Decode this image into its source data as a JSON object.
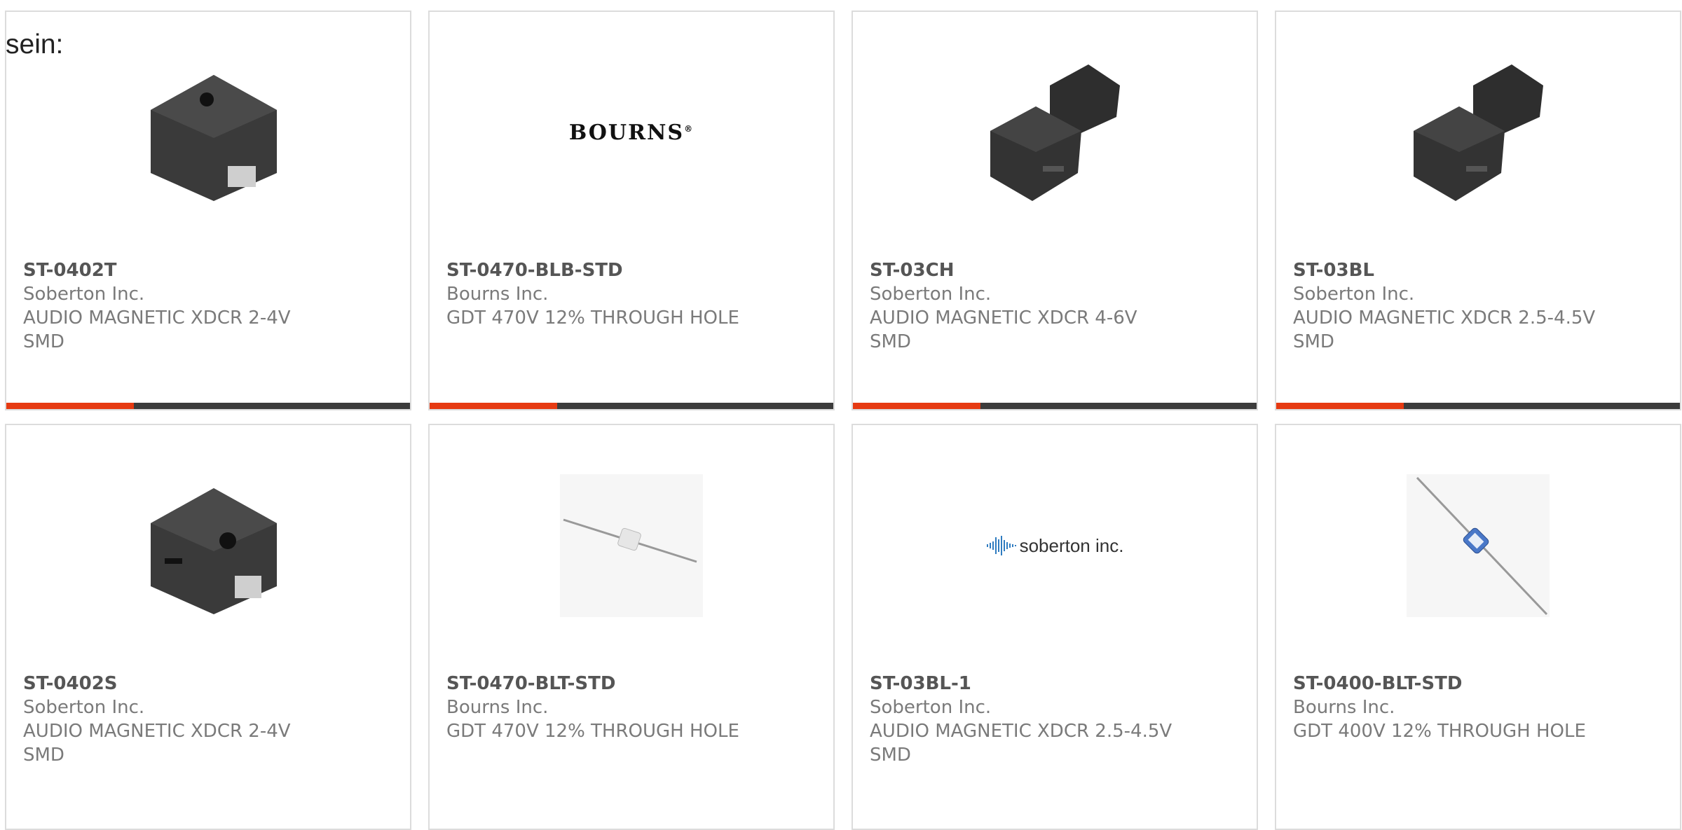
{
  "intro_text": "sein:",
  "accent_color": "#e63a12",
  "bar_color": "#3c3c3c",
  "products": [
    {
      "part": "ST-0402T",
      "manufacturer": "Soberton Inc.",
      "desc1": "AUDIO MAGNETIC XDCR 2-4V",
      "desc2": "SMD",
      "image": "smd-buzzer-square-photo"
    },
    {
      "part": "ST-0470-BLB-STD",
      "manufacturer": "Bourns Inc.",
      "desc1": "GDT 470V 12% THROUGH HOLE",
      "desc2": "",
      "image": "bourns-logo",
      "logo_text": "BOURNS"
    },
    {
      "part": "ST-03CH",
      "manufacturer": "Soberton Inc.",
      "desc1": "AUDIO MAGNETIC XDCR 4-6V",
      "desc2": "SMD",
      "image": "smd-buzzer-pair-photo"
    },
    {
      "part": "ST-03BL",
      "manufacturer": "Soberton Inc.",
      "desc1": "AUDIO MAGNETIC XDCR 2.5-4.5V",
      "desc2": "SMD",
      "image": "smd-buzzer-pair-photo"
    },
    {
      "part": "ST-0402S",
      "manufacturer": "Soberton Inc.",
      "desc1": "AUDIO MAGNETIC XDCR 2-4V",
      "desc2": "SMD",
      "image": "smd-buzzer-square-photo"
    },
    {
      "part": "ST-0470-BLT-STD",
      "manufacturer": "Bourns Inc.",
      "desc1": "GDT 470V 12% THROUGH HOLE",
      "desc2": "",
      "image": "gdt-axial-white-photo"
    },
    {
      "part": "ST-03BL-1",
      "manufacturer": "Soberton Inc.",
      "desc1": "AUDIO MAGNETIC XDCR 2.5-4.5V",
      "desc2": "SMD",
      "image": "soberton-logo",
      "logo_text": "soberton inc."
    },
    {
      "part": "ST-0400-BLT-STD",
      "manufacturer": "Bourns Inc.",
      "desc1": "GDT 400V 12% THROUGH HOLE",
      "desc2": "",
      "image": "gdt-axial-blue-photo"
    }
  ]
}
